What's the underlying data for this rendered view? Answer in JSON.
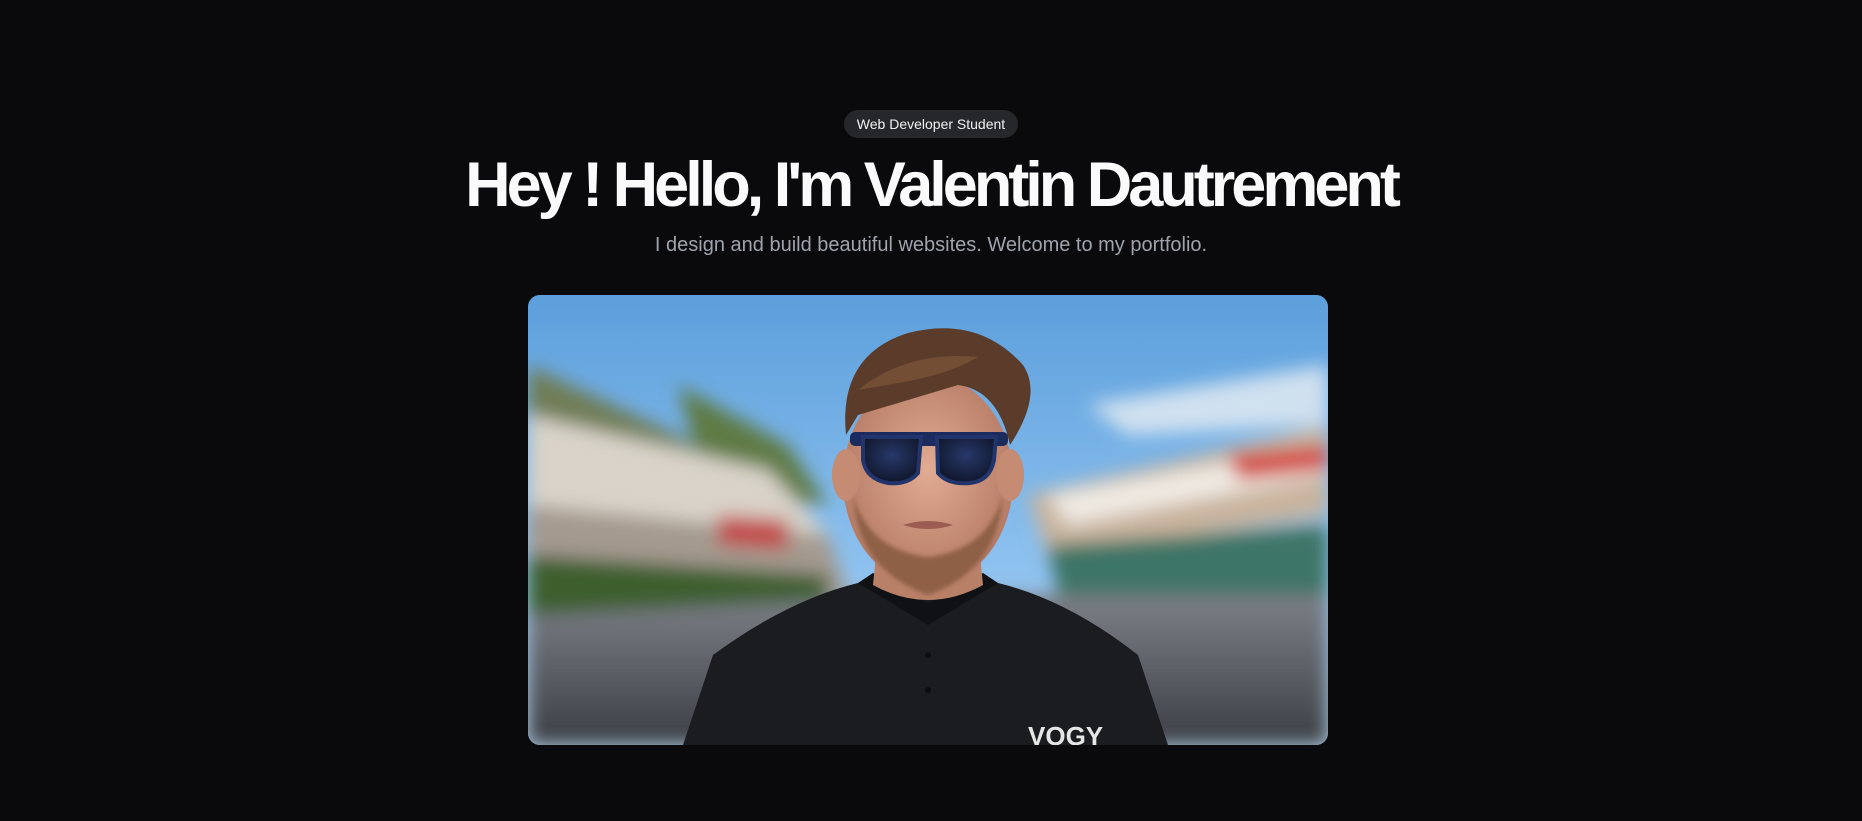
{
  "hero": {
    "badge": "Web Developer Student",
    "title": "Hey ! Hello, I'm Valentin Dautrement",
    "subtitle": "I design and build beautiful websites. Welcome to my portfolio."
  },
  "portrait": {
    "shirt_text": "VOGY"
  },
  "colors": {
    "background": "#0a0a0c",
    "badge_background": "#26272b",
    "title": "#fafafa",
    "subtitle": "#9ea3ad"
  }
}
